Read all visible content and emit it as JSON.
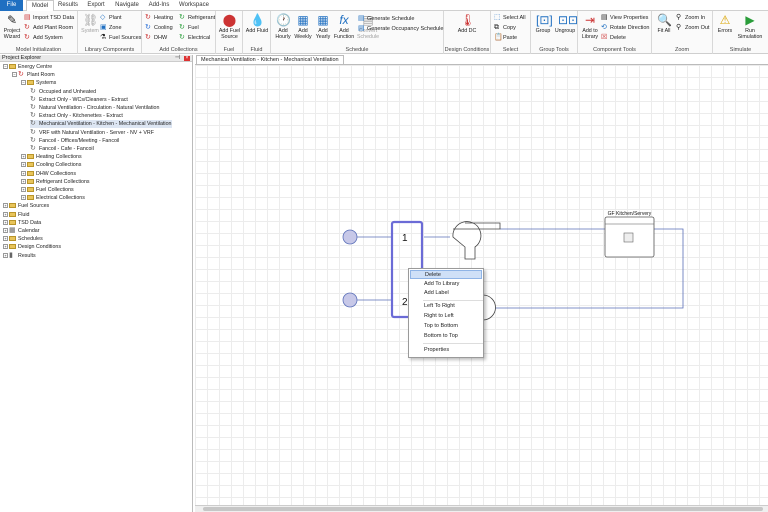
{
  "tabs": [
    "File",
    "Model",
    "Results",
    "Export",
    "Navigate",
    "Add-Ins",
    "Workspace"
  ],
  "ribbon": {
    "model_init": {
      "label": "Model Initialization",
      "wizard": "Project Wizard",
      "import_tsd": "Import TSD Data",
      "add_plant_room": "Add Plant Room",
      "add_system": "Add System"
    },
    "library_components": {
      "label": "Library Components",
      "system": "System",
      "plant": "Plant",
      "zone": "Zone",
      "fuel_sources": "Fuel Sources"
    },
    "add_collections": {
      "label": "Add Collections",
      "heating": "Heating",
      "cooling": "Cooling",
      "dhw": "DHW",
      "refrigerant": "Refrigerant",
      "fuel": "Fuel",
      "electrical": "Electrical"
    },
    "fuel": {
      "label": "Fuel",
      "btn": "Add Fuel Source"
    },
    "fluid": {
      "label": "Fluid",
      "btn": "Add Fluid"
    },
    "schedule": {
      "label": "Schedule",
      "hourly": "Add Hourly",
      "weekly": "Add Weekly",
      "yearly": "Add Yearly",
      "function": "Add Function",
      "convert": "Convert Schedule",
      "gen_schedule": "Generate Schedule",
      "gen_occupancy": "Generate Occupancy Schedule"
    },
    "design_conditions": {
      "label": "Design Conditions",
      "btn": "Add DC"
    },
    "select": {
      "label": "Select",
      "select_all": "Select All",
      "copy": "Copy",
      "paste": "Paste"
    },
    "group_tools": {
      "label": "Group Tools",
      "group": "Group",
      "ungroup": "Ungroup"
    },
    "component_tools": {
      "label": "Component Tools",
      "add_library": "Add to Library",
      "view_properties": "View Properties",
      "rotate": "Rotate Direction",
      "delete": "Delete"
    },
    "zoom": {
      "label": "Zoom",
      "fit_all": "Fit All",
      "zoom_in": "Zoom In",
      "zoom_out": "Zoom Out"
    },
    "simulate": {
      "label": "Simulate",
      "errors": "Errors",
      "run": "Run Simulation"
    }
  },
  "explorer": {
    "title": "Project Explorer",
    "tree": [
      {
        "label": "Energy Centre",
        "level": 0,
        "kind": "folder"
      },
      {
        "label": "Plant Room",
        "level": 1,
        "kind": "cycle"
      },
      {
        "label": "Systems",
        "level": 2,
        "kind": "folder"
      },
      {
        "label": "Occupied and Unheated",
        "level": 3,
        "kind": "cycle"
      },
      {
        "label": "Extract Only - WCs/Cleaners - Extract",
        "level": 3,
        "kind": "cycle"
      },
      {
        "label": "Natural Ventilation - Circulation - Natural Ventilation",
        "level": 3,
        "kind": "cycle"
      },
      {
        "label": "Extract Only - Kitchenettes - Extract",
        "level": 3,
        "kind": "cycle"
      },
      {
        "label": "Mechanical Ventilation - Kitchen - Mechanical Ventilation",
        "level": 3,
        "kind": "cycle",
        "selected": true
      },
      {
        "label": "VRF with Natural Ventilation - Server - NV + VRF",
        "level": 3,
        "kind": "cycle"
      },
      {
        "label": "Fancoil - Offices/Meeting - Fancoil",
        "level": 3,
        "kind": "cycle"
      },
      {
        "label": "Fancoil - Cafe - Fancoil",
        "level": 3,
        "kind": "cycle"
      },
      {
        "label": "Heating Collections",
        "level": 2,
        "kind": "folder"
      },
      {
        "label": "Cooling Collections",
        "level": 2,
        "kind": "folder"
      },
      {
        "label": "DHW Collections",
        "level": 2,
        "kind": "folder"
      },
      {
        "label": "Refrigerant Collections",
        "level": 2,
        "kind": "folder"
      },
      {
        "label": "Fuel Collections",
        "level": 2,
        "kind": "folder"
      },
      {
        "label": "Electrical Collections",
        "level": 2,
        "kind": "folder"
      },
      {
        "label": "Fuel Sources",
        "level": 0,
        "kind": "folder"
      },
      {
        "label": "Fluid",
        "level": 0,
        "kind": "folder"
      },
      {
        "label": "TSD Data",
        "level": 0,
        "kind": "folder"
      },
      {
        "label": "Calendar",
        "level": 0,
        "kind": "cal"
      },
      {
        "label": "Schedules",
        "level": 0,
        "kind": "folder"
      },
      {
        "label": "Design Conditions",
        "level": 0,
        "kind": "folder"
      },
      {
        "label": "Results",
        "level": 0,
        "kind": "chart"
      }
    ]
  },
  "canvas": {
    "tab": "Mechanical Ventilation - Kitchen - Mechanical Ventilation",
    "node1": "1",
    "node2": "2",
    "zone_label": "GF Kitchen/Servery"
  },
  "context_menu": [
    "Delete",
    "Add To Library",
    "Add Label",
    "Left To Right",
    "Right to Left",
    "Top to Bottom",
    "Bottom to Top",
    "Properties"
  ],
  "colors": {
    "accent": "#1f6fc1",
    "selection": "#6b6bd6"
  }
}
